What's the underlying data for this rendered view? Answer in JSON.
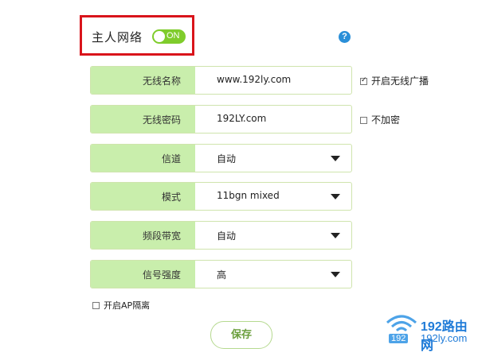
{
  "header": {
    "title": "主人网络",
    "toggle_label": "ON",
    "toggle_state": "on",
    "help_icon": "question-circle-icon"
  },
  "rows": [
    {
      "label": "无线名称",
      "value": "www.192ly.com"
    },
    {
      "label": "无线密码",
      "value": "192LY.com"
    },
    {
      "label": "信道",
      "value": "自动"
    },
    {
      "label": "模式",
      "value": "11bgn mixed"
    },
    {
      "label": "频段带宽",
      "value": "自动"
    },
    {
      "label": "信号强度",
      "value": "高"
    }
  ],
  "options": {
    "broadcast_label": "开启无线广播",
    "broadcast_checked": true,
    "no_encrypt_label": "不加密",
    "no_encrypt_checked": false,
    "ap_isolation_label": "开启AP隔离",
    "ap_isolation_checked": false
  },
  "save_label": "保存",
  "watermark": {
    "brand": "192路由网",
    "badge": "192",
    "domain": "192ly.com"
  },
  "colors": {
    "accent_green": "#7fcc2b",
    "label_bg": "#c9eeac",
    "highlight_border": "#d9141b",
    "help_blue": "#2a8fd8"
  }
}
